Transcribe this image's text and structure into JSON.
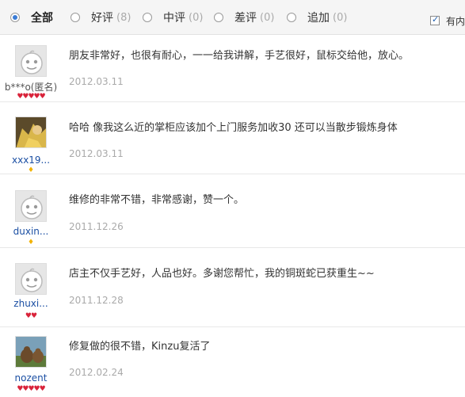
{
  "filters": [
    {
      "label": "全部",
      "count": "",
      "checked": true
    },
    {
      "label": "好评",
      "count": "(8)",
      "checked": false
    },
    {
      "label": "中评",
      "count": "(0)",
      "checked": false
    },
    {
      "label": "差评",
      "count": "(0)",
      "checked": false
    },
    {
      "label": "追加",
      "count": "(0)",
      "checked": false
    }
  ],
  "content_checkbox": {
    "label": "有内",
    "checked": true
  },
  "reviews": [
    {
      "user": "b***o(匿名)",
      "avatar": "default-avatar",
      "badge": "hearts",
      "badge_text": "♥♥♥♥♥",
      "comment": "朋友非常好，也很有耐心，一一给我讲解，手艺很好，鼠标交给他，放心。",
      "date": "2012.03.11"
    },
    {
      "user": "xxx19...",
      "avatar": "photo-avatar",
      "badge": "gold",
      "badge_text": "♦",
      "comment": "哈哈 像我这么近的掌柜应该加个上门服务加收30 还可以当散步锻炼身体",
      "date": "2012.03.11"
    },
    {
      "user": "duxin...",
      "avatar": "default-avatar",
      "badge": "gold",
      "badge_text": "♦",
      "comment": "维修的非常不错，非常感谢，赞一个。",
      "date": "2011.12.26"
    },
    {
      "user": "zhuxi...",
      "avatar": "default-avatar",
      "badge": "hearts",
      "badge_text": "♥♥",
      "comment": "店主不仅手艺好，人品也好。多谢您帮忙，我的铜斑蛇已获重生~~",
      "date": "2011.12.28"
    },
    {
      "user": "nozent",
      "avatar": "photo-avatar",
      "badge": "hearts",
      "badge_text": "♥♥♥♥♥",
      "comment": "修复做的很不错，Kinzu复活了",
      "date": "2012.02.24"
    }
  ]
}
